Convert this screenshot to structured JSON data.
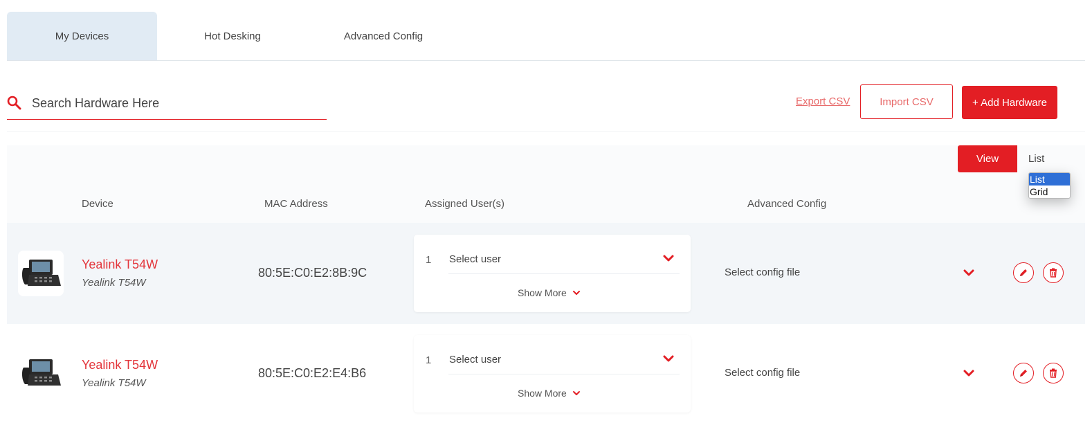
{
  "tabs": [
    {
      "label": "My Devices",
      "active": true
    },
    {
      "label": "Hot Desking",
      "active": false
    },
    {
      "label": "Advanced Config",
      "active": false
    }
  ],
  "search": {
    "placeholder": "Search Hardware Here",
    "icon": "search-icon"
  },
  "toolbar": {
    "export_label": "Export CSV",
    "import_label": "Import CSV",
    "add_label": "+ Add Hardware"
  },
  "view": {
    "button_label": "View",
    "selected": "List",
    "options": [
      "List",
      "Grid"
    ]
  },
  "table": {
    "headers": {
      "device": "Device",
      "mac": "MAC Address",
      "users": "Assigned User(s)",
      "config": "Advanced Config"
    },
    "rows": [
      {
        "name": "Yealink T54W",
        "model": "Yealink T54W",
        "mac": "80:5E:C0:E2:8B:9C",
        "user_index": "1",
        "user_placeholder": "Select user",
        "show_more": "Show More",
        "config_placeholder": "Select config file"
      },
      {
        "name": "Yealink T54W",
        "model": "Yealink T54W",
        "mac": "80:5E:C0:E2:E4:B6",
        "user_index": "1",
        "user_placeholder": "Select user",
        "show_more": "Show More",
        "config_placeholder": "Select config file"
      }
    ]
  },
  "colors": {
    "accent": "#e31e24",
    "tab_active_bg": "#e1ebf4",
    "row_shade": "#f3f6f9"
  },
  "icons": [
    "search-icon",
    "chevron-down-icon",
    "pencil-icon",
    "trash-icon",
    "desk-phone-icon"
  ]
}
